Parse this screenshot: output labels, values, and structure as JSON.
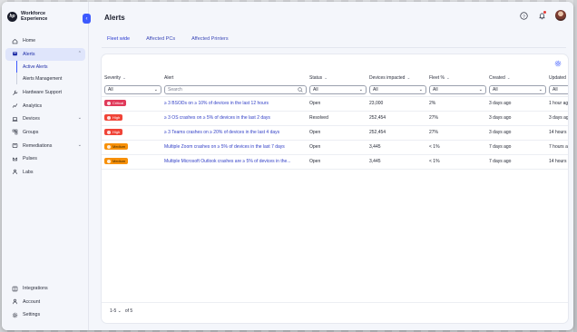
{
  "app": {
    "brand": "Workforce Experience",
    "logo_text": "hp"
  },
  "sidebar": {
    "items": [
      {
        "label": "Home",
        "icon": "home-icon",
        "name": "sidebar-item-home"
      },
      {
        "label": "Alerts",
        "icon": "alert-icon",
        "name": "sidebar-item-alerts",
        "active": true,
        "expanded": true
      },
      {
        "label": "Hardware Support",
        "icon": "wrench-icon",
        "name": "sidebar-item-hardware-support"
      },
      {
        "label": "Analytics",
        "icon": "chart-icon",
        "name": "sidebar-item-analytics"
      },
      {
        "label": "Devices",
        "icon": "laptop-icon",
        "name": "sidebar-item-devices",
        "chevron": true
      },
      {
        "label": "Groups",
        "icon": "groups-icon",
        "name": "sidebar-item-groups"
      },
      {
        "label": "Remediations",
        "icon": "remediation-icon",
        "name": "sidebar-item-remediations",
        "chevron": true
      },
      {
        "label": "Pulses",
        "icon": "pulse-icon",
        "name": "sidebar-item-pulses"
      },
      {
        "label": "Labs",
        "icon": "labs-icon",
        "name": "sidebar-item-labs"
      }
    ],
    "alerts_sub": [
      "Active Alerts",
      "Alerts Management"
    ],
    "bottom": [
      {
        "label": "Integrations",
        "icon": "integrations-icon",
        "name": "sidebar-item-integrations"
      },
      {
        "label": "Account",
        "icon": "account-icon",
        "name": "sidebar-item-account"
      },
      {
        "label": "Settings",
        "icon": "settings-icon",
        "name": "sidebar-item-settings"
      }
    ]
  },
  "header": {
    "title": "Alerts"
  },
  "tabs": [
    "Fleet wide",
    "Affected PCs",
    "Affected Printers"
  ],
  "table": {
    "columns": [
      "Severity",
      "Alert",
      "Status",
      "Devices impacted",
      "Fleet %",
      "Created",
      "Updated"
    ],
    "filters": {
      "severity": "All",
      "search_placeholder": "Search",
      "status": "All",
      "devices": "All",
      "fleet": "All",
      "created": "All",
      "updated": "All"
    },
    "rows": [
      {
        "severity": "Critical",
        "level": "critical",
        "alert": "≥ 3 BSODs on ≥ 10% of devices in the last 12 hours",
        "status": "Open",
        "devices": "23,000",
        "fleet": "2%",
        "created": "3 days ago",
        "updated": "1 hour ago"
      },
      {
        "severity": "High",
        "level": "high",
        "alert": "≥ 3 OS crashes on ≥ 5% of devices in the last 2 days",
        "status": "Resolved",
        "devices": "252,454",
        "fleet": "27%",
        "created": "3 days ago",
        "updated": "3 days ago"
      },
      {
        "severity": "High",
        "level": "high",
        "alert": "≥ 3 Teams crashes on ≥ 20% of devices in the last 4 days",
        "status": "Open",
        "devices": "252,454",
        "fleet": "27%",
        "created": "3 days ago",
        "updated": "14 hours ago"
      },
      {
        "severity": "Medium",
        "level": "medium",
        "alert": "Multiple Zoom crashes on ≥ 5% of devices in the last 7 days",
        "status": "Open",
        "devices": "3,445",
        "fleet": "< 1%",
        "created": "7 days ago",
        "updated": "7 hours ago"
      },
      {
        "severity": "Medium",
        "level": "medium",
        "alert": "Multiple Microsoft Outlook crashes are ≥ 5% of devices in the...",
        "status": "Open",
        "devices": "3,445",
        "fleet": "< 1%",
        "created": "7 days ago",
        "updated": "14 hours ago"
      }
    ]
  },
  "pager": {
    "range": "1-5",
    "of": "of 5"
  },
  "colors": {
    "accent": "#3d5afe",
    "critical": "#e03a5a",
    "high": "#f04438",
    "medium": "#f79009"
  }
}
